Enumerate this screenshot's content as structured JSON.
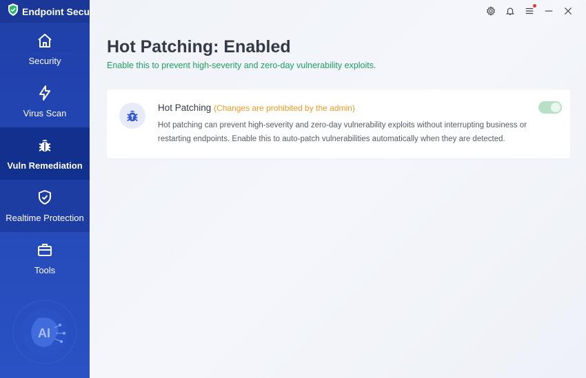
{
  "app": {
    "brand_name": "Endpoint Secure",
    "brand_color": "#1b3797"
  },
  "sidebar": {
    "items": [
      {
        "label": "Security",
        "icon": "home-icon",
        "active": false
      },
      {
        "label": "Virus Scan",
        "icon": "lightning-icon",
        "active": false
      },
      {
        "label": "Vuln Remediation",
        "icon": "bug-icon",
        "active": true
      },
      {
        "label": "Realtime Protection",
        "icon": "shield-check-icon",
        "active": false
      },
      {
        "label": "Tools",
        "icon": "toolbox-icon",
        "active": false
      }
    ],
    "ai_badge": "AI"
  },
  "window_controls": {
    "icons": [
      "settings-icon",
      "bell-icon",
      "menu-icon",
      "minimize-icon",
      "close-icon"
    ],
    "menu_has_notification": true
  },
  "main": {
    "title": "Hot Patching: Enabled",
    "subtitle": "Enable this to prevent high-severity and zero-day vulnerability exploits.",
    "card": {
      "title": "Hot Patching",
      "note": "(Changes are prohibited by the admin)",
      "description": "Hot patching can prevent high-severity and zero-day vulnerability exploits without interrupting business or restarting endpoints. Enable this to auto-patch vulnerabilities automatically when they are detected.",
      "toggle_on": true,
      "toggle_disabled": true
    }
  },
  "colors": {
    "accent_green": "#1f9e5e",
    "warning_orange": "#f5961f",
    "sidebar_blue": "#2447b5"
  }
}
